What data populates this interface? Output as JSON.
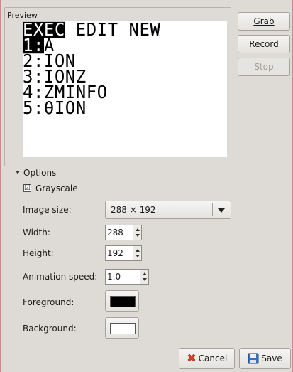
{
  "preview": {
    "label": "Preview",
    "screen_lines": [
      {
        "inv": "EXEC",
        "rest": " EDIT NEW"
      },
      {
        "inv": "1:",
        "rest": "A"
      },
      {
        "inv": "",
        "rest": "2:ION"
      },
      {
        "inv": "",
        "rest": "3:IONZ"
      },
      {
        "inv": "",
        "rest": "4:ZMINFO"
      },
      {
        "inv": "",
        "rest": "5:θION"
      }
    ]
  },
  "buttons": {
    "grab": "Grab",
    "record": "Record",
    "stop": "Stop",
    "cancel": "Cancel",
    "save": "Save"
  },
  "options": {
    "title": "Options",
    "grayscale_label": "Grayscale",
    "grayscale_checked": "☑",
    "image_size_label": "Image size:",
    "image_size_value": "288 × 192",
    "width_label": "Width:",
    "width_value": "288",
    "height_label": "Height:",
    "height_value": "192",
    "speed_label": "Animation speed:",
    "speed_value": "1.0",
    "foreground_label": "Foreground:",
    "foreground_color": "#000000",
    "background_label": "Background:",
    "background_color": "#ffffff"
  }
}
